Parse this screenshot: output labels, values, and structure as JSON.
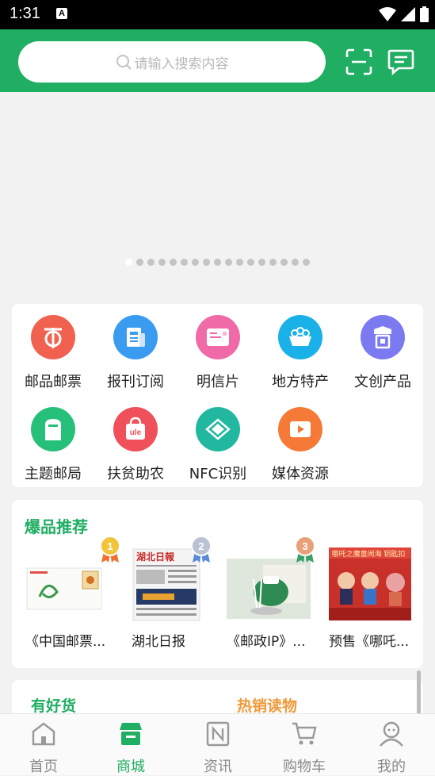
{
  "status_bar": {
    "time": "1:31",
    "notification_badge": "A"
  },
  "header": {
    "search_placeholder": "请输入搜索内容",
    "colors": {
      "brand": "#1fae62"
    }
  },
  "banner": {
    "page_count": 17,
    "active_index": 0
  },
  "categories": [
    {
      "label": "邮品邮票",
      "icon": "stamp-icon",
      "color": "#f0614f"
    },
    {
      "label": "报刊订阅",
      "icon": "newspaper-icon",
      "color": "#3a9cf0"
    },
    {
      "label": "明信片",
      "icon": "postcard-icon",
      "color": "#f06aa8"
    },
    {
      "label": "地方特产",
      "icon": "specialty-icon",
      "color": "#1ab0e8"
    },
    {
      "label": "文创产品",
      "icon": "creative-icon",
      "color": "#7b7af0"
    },
    {
      "label": "主题邮局",
      "icon": "mailbox-icon",
      "color": "#26c07a"
    },
    {
      "label": "扶贫助农",
      "icon": "ule-bag-icon",
      "color": "#f0505a"
    },
    {
      "label": "NFC识别",
      "icon": "nfc-icon",
      "color": "#22b8a0"
    },
    {
      "label": "媒体资源",
      "icon": "video-icon",
      "color": "#f57a38"
    }
  ],
  "hot": {
    "title": "爆品推荐",
    "items": [
      {
        "name": "《中国邮票...",
        "rank": "1"
      },
      {
        "name": "湖北日报",
        "rank": "2"
      },
      {
        "name": "《邮政IP》...",
        "rank": "3"
      },
      {
        "name": "预售《哪吒..."
      }
    ]
  },
  "sections": {
    "left": "有好货",
    "right": "热销读物"
  },
  "tabs": [
    {
      "label": "首页",
      "icon": "home-icon",
      "active": false
    },
    {
      "label": "商城",
      "icon": "store-icon",
      "active": true
    },
    {
      "label": "资讯",
      "icon": "news-icon",
      "active": false
    },
    {
      "label": "购物车",
      "icon": "cart-icon",
      "active": false
    },
    {
      "label": "我的",
      "icon": "profile-icon",
      "active": false
    }
  ]
}
